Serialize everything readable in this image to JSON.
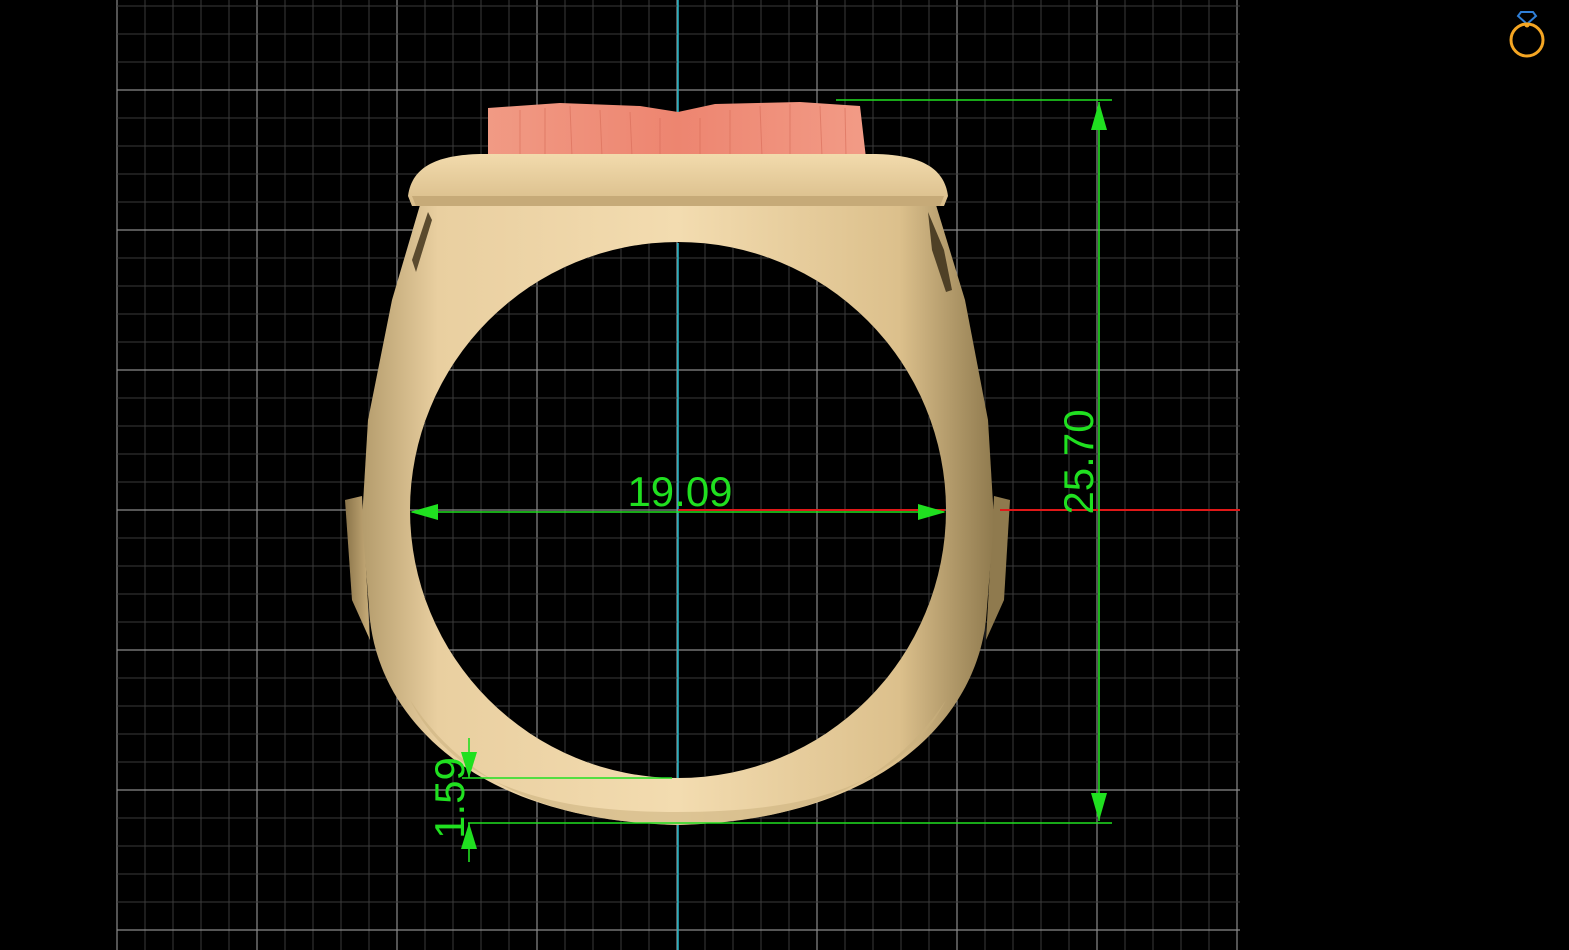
{
  "viewport": {
    "background": "#000000",
    "grid": {
      "major_color": "#8a8a8a",
      "minor_color": "#3a3a3a"
    },
    "axes": {
      "vertical_axis_color": "#1fb6c8",
      "horizontal_axis_color": "#e01818"
    }
  },
  "model": {
    "metal_color": "#e6c99a",
    "metal_shadow": "#9a8458",
    "stone_color": "#ef8a76"
  },
  "dimensions": {
    "color": "#20e020",
    "inner_diameter": "19.09",
    "total_height": "25.70",
    "shank_thickness": "1.59"
  },
  "app_icon": {
    "name": "ring-icon",
    "color": "#f5a623",
    "gem_color": "#2f7fd8"
  }
}
